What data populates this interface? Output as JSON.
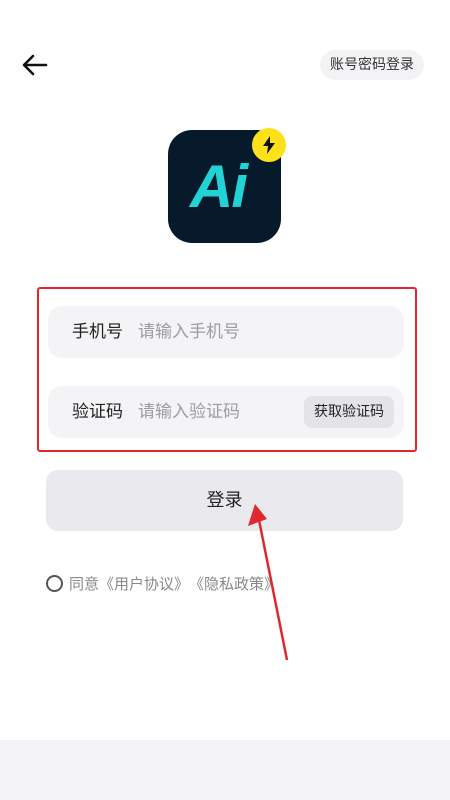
{
  "header": {
    "back_icon": "arrow-left-icon",
    "password_login_label": "账号密码登录"
  },
  "logo": {
    "text": "Ai",
    "badge_icon": "lightning-icon",
    "colors": {
      "tile": "#071a2b",
      "text": "#22d3d6",
      "badge": "#ffe11a"
    }
  },
  "form": {
    "phone": {
      "label": "手机号",
      "placeholder": "请输入手机号",
      "value": ""
    },
    "code": {
      "label": "验证码",
      "placeholder": "请输入验证码",
      "value": "",
      "get_code_label": "获取验证码"
    },
    "highlight_color": "#e0282e"
  },
  "login": {
    "label": "登录"
  },
  "agreement": {
    "checked": false,
    "prefix": "同意",
    "user_agreement": "《用户协议》",
    "privacy_policy": "《隐私政策》"
  },
  "annotation": {
    "color": "#e0282e"
  }
}
